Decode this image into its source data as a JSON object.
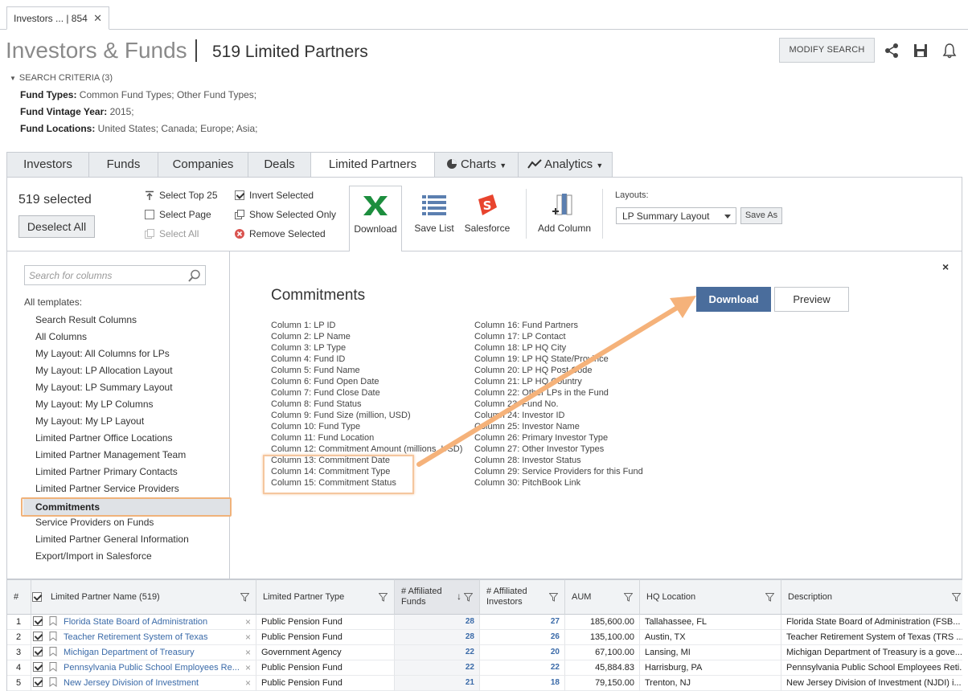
{
  "doc_tab": {
    "label": "Investors ...  | 854",
    "close": "✕"
  },
  "header": {
    "title": "Investors & Funds",
    "subtitle": "519 Limited Partners",
    "modify_label": "MODIFY SEARCH"
  },
  "criteria": {
    "toggle": "SEARCH CRITERIA (3)",
    "rows": [
      {
        "label": "Fund Types:",
        "value": "Common Fund Types; Other Fund Types;"
      },
      {
        "label": "Fund Vintage Year:",
        "value": "2015;"
      },
      {
        "label": "Fund Locations:",
        "value": "United States; Canada; Europe; Asia;"
      }
    ]
  },
  "tabs": [
    "Investors",
    "Funds",
    "Companies",
    "Deals",
    "Limited Partners",
    "Charts",
    "Analytics"
  ],
  "toolbar": {
    "selected": "519 selected",
    "deselect": "Deselect All",
    "opts": [
      "Select Top 25",
      "Select Page",
      "Select All",
      "Invert Selected",
      "Show Selected Only",
      "Remove Selected"
    ],
    "download": "Download",
    "save_list": "Save List",
    "salesforce": "Salesforce",
    "add_column": "Add Column",
    "layouts_label": "Layouts:",
    "layout_value": "LP Summary Layout",
    "save_as": "Save As"
  },
  "left": {
    "search_placeholder": "Search for columns",
    "all_templates": "All templates:",
    "items": [
      "Search Result Columns",
      "All Columns",
      "My Layout: All Columns for LPs",
      "My Layout: LP Allocation Layout",
      "My Layout: LP Summary Layout",
      "My Layout: My LP Columns",
      "My Layout: My LP Layout",
      "Limited Partner Office Locations",
      "Limited Partner Management Team",
      "Limited Partner Primary Contacts",
      "Limited Partner Service Providers",
      "Commitments",
      "Service Providers on Funds",
      "Limited Partner General Information",
      "Export/Import in Salesforce"
    ]
  },
  "detail": {
    "close": "×",
    "title": "Commitments",
    "download": "Download",
    "preview": "Preview",
    "cols_left": [
      "Column 1: LP ID",
      "Column 2: LP Name",
      "Column 3: LP Type",
      "Column 4: Fund ID",
      "Column 5: Fund Name",
      "Column 6: Fund Open Date",
      "Column 7: Fund Close Date",
      "Column 8: Fund Status",
      "Column 9: Fund Size (million, USD)",
      "Column 10: Fund Type",
      "Column 11: Fund Location",
      "Column 12: Commitment Amount (millions, USD)",
      "Column 13: Commitment Date",
      "Column 14: Commitment Type",
      "Column 15: Commitment Status"
    ],
    "cols_right": [
      "Column 16: Fund Partners",
      "Column 17: LP Contact",
      "Column 18: LP HQ City",
      "Column 19: LP HQ State/Province",
      "Column 20: LP HQ Post Code",
      "Column 21: LP HQ Country",
      "Column 22: Other LPs in the Fund",
      "Column 23: Fund No.",
      "Column 24: Investor ID",
      "Column 25: Investor Name",
      "Column 26: Primary Investor Type",
      "Column 27: Other Investor Types",
      "Column 28: Investor Status",
      "Column 29: Service Providers for this Fund",
      "Column 30: PitchBook Link"
    ]
  },
  "grid": {
    "headers": {
      "num": "#",
      "name": "Limited Partner Name  (519)",
      "type": "Limited Partner Type",
      "aff_funds": "# Affiliated Funds",
      "aff_inv": "# Affiliated Investors",
      "aum": "AUM",
      "hq": "HQ Location",
      "desc": "Description"
    },
    "rows": [
      {
        "n": "1",
        "name": "Florida State Board of Administration",
        "type": "Public Pension Fund",
        "funds": "28",
        "inv": "27",
        "aum": "185,600.00",
        "hq": "Tallahassee, FL",
        "desc": "Florida State Board of Administration (FSB..."
      },
      {
        "n": "2",
        "name": "Teacher Retirement System of Texas",
        "type": "Public Pension Fund",
        "funds": "28",
        "inv": "26",
        "aum": "135,100.00",
        "hq": "Austin, TX",
        "desc": "Teacher Retirement System of Texas (TRS ..."
      },
      {
        "n": "3",
        "name": "Michigan Department of Treasury",
        "type": "Government Agency",
        "funds": "22",
        "inv": "20",
        "aum": "67,100.00",
        "hq": "Lansing, MI",
        "desc": "Michigan Department of Treasury is a gove..."
      },
      {
        "n": "4",
        "name": "Pennsylvania Public School Employees Re...",
        "type": "Public Pension Fund",
        "funds": "22",
        "inv": "22",
        "aum": "45,884.83",
        "hq": "Harrisburg, PA",
        "desc": "Pennsylvania Public School Employees Reti..."
      },
      {
        "n": "5",
        "name": "New Jersey Division of Investment",
        "type": "Public Pension Fund",
        "funds": "21",
        "inv": "18",
        "aum": "79,150.00",
        "hq": "Trenton, NJ",
        "desc": "New Jersey Division of Investment (NJDI) i..."
      }
    ]
  },
  "colors": {
    "accent": "#4a6d9c",
    "highlight": "#f5b27a",
    "link": "#3a6aa8"
  }
}
